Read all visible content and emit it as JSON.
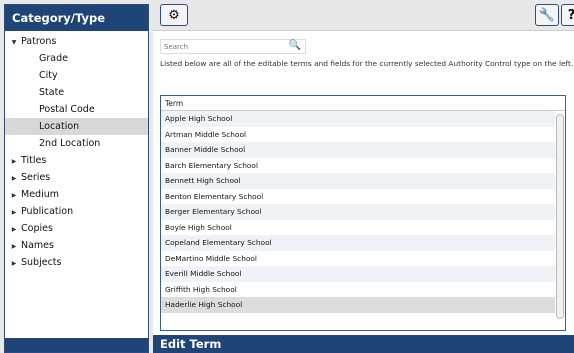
{
  "sidebar": {
    "title": "Category/Type",
    "items": [
      {
        "label": "Patrons",
        "arrow": "▼",
        "expanded": true
      },
      {
        "label": "Grade",
        "child": true
      },
      {
        "label": "City",
        "child": true
      },
      {
        "label": "State",
        "child": true
      },
      {
        "label": "Postal Code",
        "child": true
      },
      {
        "label": "Location",
        "child": true,
        "selected": true
      },
      {
        "label": "2nd Location",
        "child": true
      },
      {
        "label": "Titles",
        "arrow": "▶"
      },
      {
        "label": "Series",
        "arrow": "▶"
      },
      {
        "label": "Medium",
        "arrow": "▶"
      },
      {
        "label": "Publication",
        "arrow": "▶"
      },
      {
        "label": "Copies",
        "arrow": "▶"
      },
      {
        "label": "Names",
        "arrow": "▶"
      },
      {
        "label": "Subjects",
        "arrow": "▶"
      }
    ]
  },
  "toolbar": {
    "gear_icon": "⚙",
    "wrench_icon": "🔧",
    "help_icon": "?"
  },
  "search": {
    "placeholder": "Search",
    "icon": "🔍"
  },
  "main": {
    "description": "Listed below are all of the editable terms and fields for the currently selected Authority Control type on the left."
  },
  "grid": {
    "column_header": "Term",
    "rows": [
      "Apple High School",
      "Artman Middle School",
      "Banner Middle School",
      "Barch Elementary School",
      "Bennett High School",
      "Benton Elementary School",
      "Berger Elementary School",
      "Boyle High School",
      "Copeland Elementary School",
      "DeMartino Middle School",
      "Everill Middle School",
      "Griffith High School",
      "Haderlie High School"
    ],
    "selected_row": "Haderlie High School"
  },
  "edit_bar": {
    "title": "Edit Term"
  }
}
